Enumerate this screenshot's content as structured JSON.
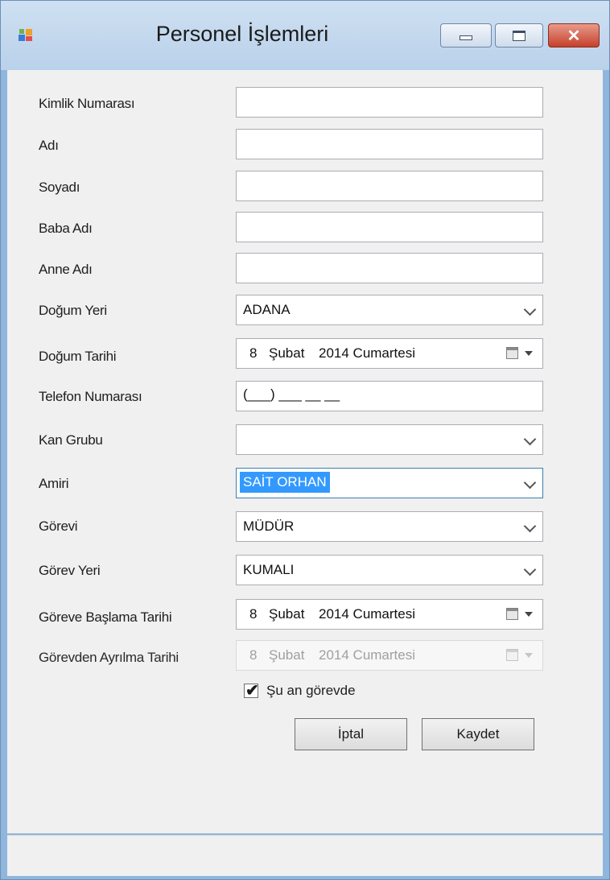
{
  "window": {
    "title": "Personel İşlemleri",
    "controls": {
      "minimize": "minimize-icon",
      "maximize": "maximize-icon",
      "close": "close-icon"
    }
  },
  "form": {
    "labels": {
      "kimlik": "Kimlik Numarası",
      "adi": "Adı",
      "soyadi": "Soyadı",
      "baba": "Baba Adı",
      "anne": "Anne Adı",
      "dogum_yeri": "Doğum Yeri",
      "dogum_tarihi": "Doğum Tarihi",
      "telefon": "Telefon Numarası",
      "kan": "Kan Grubu",
      "amiri": "Amiri",
      "gorevi": "Görevi",
      "gorev_yeri": "Görev Yeri",
      "baslama": "Göreve Başlama Tarihi",
      "ayrilma": "Görevden Ayrılma Tarihi"
    },
    "values": {
      "kimlik": "",
      "adi": "",
      "soyadi": "",
      "baba": "",
      "anne": "",
      "dogum_yeri": "ADANA",
      "telefon": "(___) ___ __ __",
      "kan": "",
      "amiri": "SAİT ORHAN",
      "gorevi": "MÜDÜR",
      "gorev_yeri": "KUMALI"
    },
    "dates": {
      "dogum": {
        "day": "8",
        "month": "Şubat",
        "rest": "2014 Cumartesi"
      },
      "baslama": {
        "day": "8",
        "month": "Şubat",
        "rest": "2014 Cumartesi"
      },
      "ayrilma": {
        "day": "8",
        "month": "Şubat",
        "rest": "2014 Cumartesi"
      }
    },
    "checkbox": {
      "label": "Şu an görevde",
      "checked": true
    },
    "buttons": {
      "cancel": "İptal",
      "save": "Kaydet"
    }
  },
  "colors": {
    "selection": "#3399ff",
    "titlebar": "#b9d1ea",
    "close_button": "#c6402c",
    "client": "#f0f0f0"
  }
}
